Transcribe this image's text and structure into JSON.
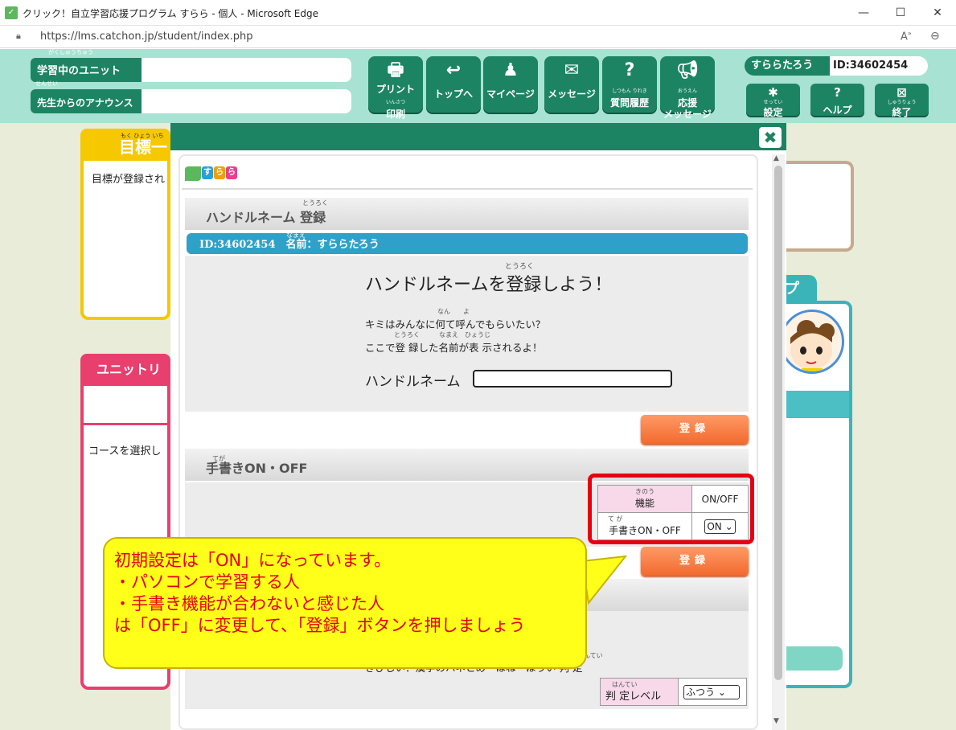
{
  "window": {
    "title": "クリック！自立学習応援プログラム すらら - 個人 - Microsoft Edge",
    "url": "https://lms.catchon.jp/student/index.php",
    "controls": [
      "—",
      "☐",
      "✕"
    ]
  },
  "header": {
    "studying_unit_label": "学習中のユニット",
    "studying_unit_ruby": "がくしゅうちゅう",
    "announce_label": "先生からのアナウンス",
    "announce_ruby": "せんせい",
    "nav": [
      {
        "label": "プリント",
        "sub": "印刷",
        "ruby": "いんさつ",
        "icon": "printer-icon"
      },
      {
        "label": "トップへ",
        "sub": "",
        "ruby": "",
        "icon": "return-icon"
      },
      {
        "label": "マイページ",
        "sub": "",
        "ruby": "",
        "icon": "person-icon"
      },
      {
        "label": "メッセージ",
        "sub": "",
        "ruby": "",
        "icon": "mail-icon"
      },
      {
        "label": "質問履歴",
        "sub": "",
        "ruby": "しつもん りれき",
        "icon": "question-bubble-icon"
      },
      {
        "label": "応援",
        "sub": "メッセージ",
        "ruby": "おうえん",
        "icon": "megaphone-icon"
      }
    ],
    "user_name": "すららたろう",
    "user_id": "ID:34602454",
    "settings_label": "設定",
    "settings_ruby": "せってい",
    "help_label": "ヘルプ",
    "exit_label": "終了",
    "exit_ruby": "しゅうりょう"
  },
  "background_page": {
    "goal_title": "目標一",
    "goal_ruby": "もく ひょう いち",
    "goal_text": "目標が登録され",
    "unit_title": "ユニットリ",
    "course_text": "コースを選択し",
    "right_tab": "プ"
  },
  "modal": {
    "close": "✖",
    "logo_letters": [
      "す",
      "ら",
      "ら"
    ],
    "section1_title": "ハンドルネーム 登録",
    "section1_ruby": "とうろく",
    "id_strip": "ID:34602454　名前：すららたろう",
    "id_strip_ruby": "なまえ",
    "hn_title": "ハンドルネームを登録しよう！",
    "hn_title_ruby": "とうろく",
    "hn_line1": "キミはみんなに何て呼んでもらいたい？",
    "hn_line1_ruby": "なん　　よ",
    "hn_line2": "ここで登 録した名前が表 示されるよ！",
    "hn_line2_ruby": "とうろく　　　なまえ　ひょうじ",
    "hn_label": "ハンドルネーム",
    "hn_value": "",
    "register_label": "登録",
    "section2_title": "手書きON・OFF",
    "section2_ruby": "てが",
    "fn_header": "機能",
    "fn_header_ruby": "きのう",
    "onoff_header": "ON/OFF",
    "fn_row": "手書きON・OFF",
    "fn_row_ruby": "て が",
    "fn_value": "ON",
    "judge_text": "きびしい：漢字のハネとめ　はね　ほうい 判 定",
    "judge_ruby": "はんてい",
    "level_label": "判 定レベル",
    "level_ruby": "はんてい",
    "level_value": "ふつう"
  },
  "callout": {
    "lines": [
      "初期設定は「ON」になっています。",
      "・パソコンで学習する人",
      "・手書き機能が合わないと感じた人",
      "は「OFF」に変更して、「登録」ボタンを押しましょう"
    ]
  },
  "colors": {
    "header_bg": "#a8e2d2",
    "header_green": "#1d8463",
    "accent_orange": "#f26a2e",
    "callout_yellow": "#ffff1a",
    "callout_text": "#e60012",
    "id_strip_blue": "#2fa0c8"
  }
}
